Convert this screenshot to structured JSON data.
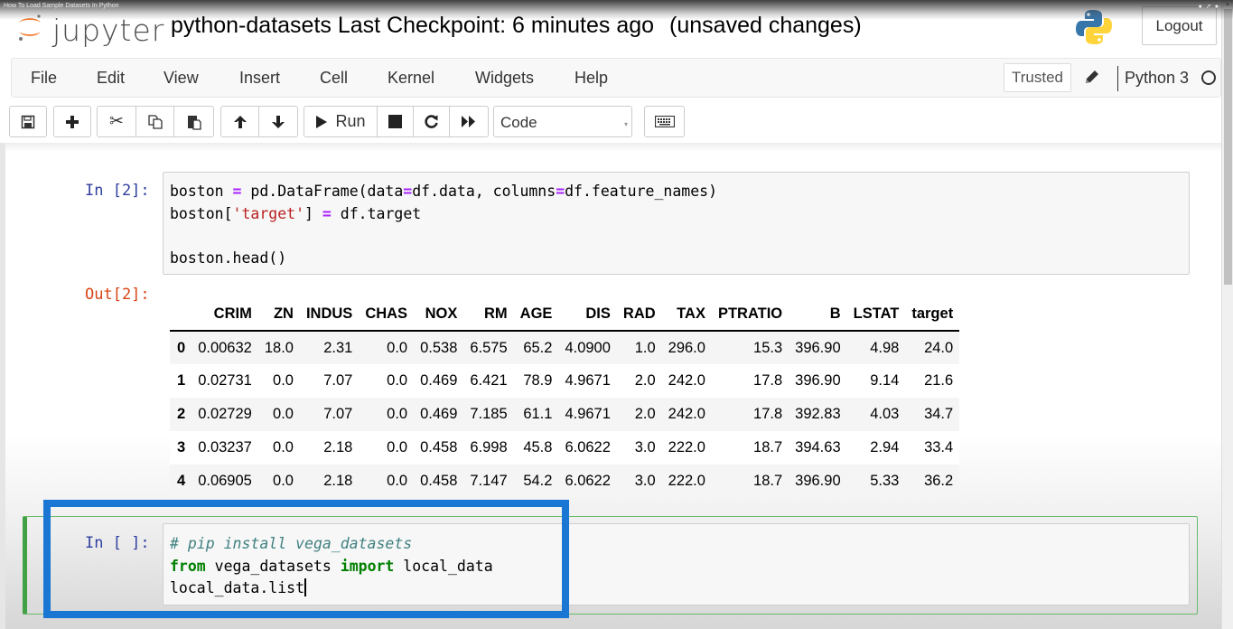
{
  "video_overlay": {
    "title": "How To Load Sample Datasets In Python",
    "icons": [
      "clock-icon",
      "share-icon",
      "info-icon"
    ]
  },
  "header": {
    "logo_text": "jupyter",
    "notebook_name": "python-datasets",
    "checkpoint": "Last Checkpoint: 6 minutes ago",
    "unsaved": "(unsaved changes)",
    "logout_label": "Logout"
  },
  "menubar": {
    "items": [
      "File",
      "Edit",
      "View",
      "Insert",
      "Cell",
      "Kernel",
      "Widgets",
      "Help"
    ],
    "trusted_label": "Trusted",
    "kernel_name": "Python 3"
  },
  "toolbar": {
    "run_label": "Run",
    "cell_type": "Code",
    "buttons": [
      "save-icon",
      "add-cell-icon",
      "cut-icon",
      "copy-icon",
      "paste-icon",
      "move-up-icon",
      "move-down-icon",
      "run-icon",
      "stop-icon",
      "restart-icon",
      "fast-forward-icon",
      "keyboard-icon"
    ]
  },
  "cells": [
    {
      "prompt_in": "In [2]:",
      "prompt_out": "Out[2]:",
      "code_lines": [
        "boston = pd.DataFrame(data=df.data, columns=df.feature_names)",
        "boston['target'] = df.target",
        "",
        "boston.head()"
      ],
      "output_table": {
        "columns": [
          "",
          "CRIM",
          "ZN",
          "INDUS",
          "CHAS",
          "NOX",
          "RM",
          "AGE",
          "DIS",
          "RAD",
          "TAX",
          "PTRATIO",
          "B",
          "LSTAT",
          "target"
        ],
        "rows": [
          [
            "0",
            "0.00632",
            "18.0",
            "2.31",
            "0.0",
            "0.538",
            "6.575",
            "65.2",
            "4.0900",
            "1.0",
            "296.0",
            "15.3",
            "396.90",
            "4.98",
            "24.0"
          ],
          [
            "1",
            "0.02731",
            "0.0",
            "7.07",
            "0.0",
            "0.469",
            "6.421",
            "78.9",
            "4.9671",
            "2.0",
            "242.0",
            "17.8",
            "396.90",
            "9.14",
            "21.6"
          ],
          [
            "2",
            "0.02729",
            "0.0",
            "7.07",
            "0.0",
            "0.469",
            "7.185",
            "61.1",
            "4.9671",
            "2.0",
            "242.0",
            "17.8",
            "392.83",
            "4.03",
            "34.7"
          ],
          [
            "3",
            "0.03237",
            "0.0",
            "2.18",
            "0.0",
            "0.458",
            "6.998",
            "45.8",
            "6.0622",
            "3.0",
            "222.0",
            "18.7",
            "394.63",
            "2.94",
            "33.4"
          ],
          [
            "4",
            "0.06905",
            "0.0",
            "2.18",
            "0.0",
            "0.458",
            "7.147",
            "54.2",
            "6.0622",
            "3.0",
            "222.0",
            "18.7",
            "396.90",
            "5.33",
            "36.2"
          ]
        ]
      }
    },
    {
      "prompt_in": "In [ ]:",
      "code_lines": [
        "# pip install vega_datasets",
        "from vega_datasets import local_data",
        "local_data.list"
      ]
    }
  ],
  "colors": {
    "highlight_box": "#1976d2",
    "selected_cell_border": "#42a045",
    "prompt_in": "#303f9f",
    "prompt_out": "#d84315"
  }
}
